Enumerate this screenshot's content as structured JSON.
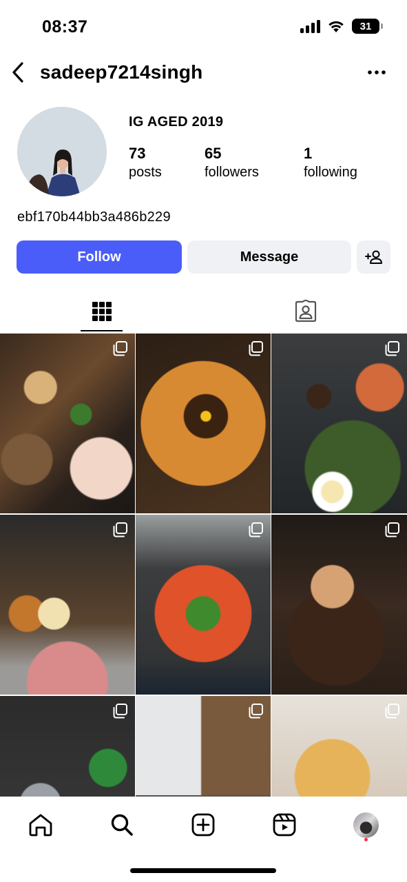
{
  "status_bar": {
    "time": "08:37",
    "battery_level": "31",
    "icons": [
      "cellular-signal-icon",
      "wifi-icon",
      "battery-icon"
    ]
  },
  "header": {
    "username": "sadeep7214singh",
    "back_icon": "chevron-left-icon",
    "more_icon": "more-horizontal-icon"
  },
  "profile": {
    "name": "IG AGED 2019",
    "bio": "ebf170b44bb3a486b229",
    "stats": [
      {
        "count": "73",
        "label": "posts"
      },
      {
        "count": "65",
        "label": "followers"
      },
      {
        "count": "1",
        "label": "following"
      }
    ]
  },
  "actions": {
    "follow_label": "Follow",
    "message_label": "Message",
    "suggest_icon": "add-person-icon"
  },
  "tabs": [
    {
      "name": "posts-grid",
      "icon": "grid-icon",
      "active": true
    },
    {
      "name": "tagged",
      "icon": "tagged-user-icon",
      "active": false
    }
  ],
  "posts": [
    {
      "subject": "korean-seafood-spread",
      "multiple": true
    },
    {
      "subject": "fried-rice-pan-with-egg",
      "multiple": true
    },
    {
      "subject": "bibimbap-and-pasta-table",
      "multiple": true
    },
    {
      "subject": "grilled-plates-and-pork-belly",
      "multiple": true
    },
    {
      "subject": "spicy-hotpot-with-greens",
      "multiple": true
    },
    {
      "subject": "bread-on-cast-iron-pan",
      "multiple": true
    },
    {
      "subject": "soju-bottle-and-side-dishes",
      "multiple": true
    },
    {
      "subject": "restaurant-interior",
      "multiple": true
    },
    {
      "subject": "fried-dough-snacks",
      "multiple": true
    }
  ],
  "bottom_nav": [
    {
      "name": "home",
      "icon": "home-icon"
    },
    {
      "name": "search",
      "icon": "search-icon"
    },
    {
      "name": "create",
      "icon": "plus-square-icon"
    },
    {
      "name": "reels",
      "icon": "reels-icon"
    },
    {
      "name": "profile",
      "icon": "profile-avatar-icon"
    }
  ],
  "colors": {
    "follow_button": "#4a5df9",
    "secondary_button": "#eff1f4",
    "notification_dot": "#ff2a4d",
    "text": "#000000"
  }
}
